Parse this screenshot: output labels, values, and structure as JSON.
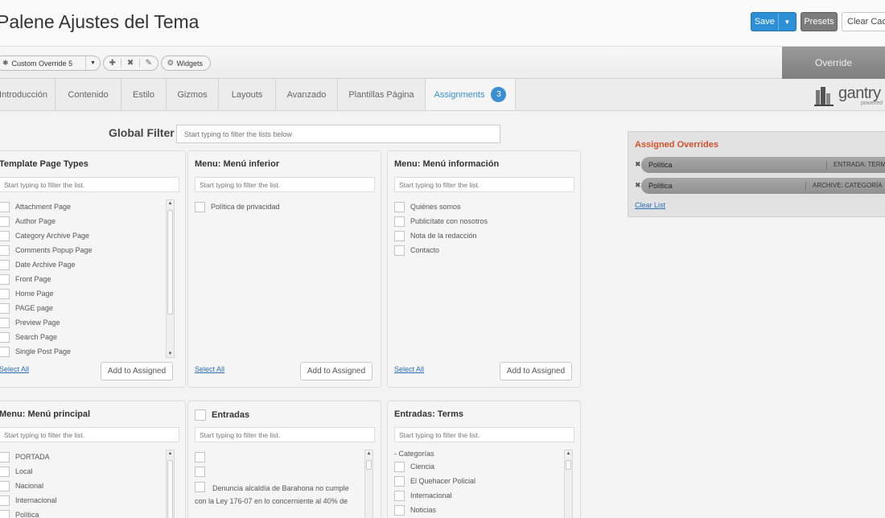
{
  "header": {
    "title": "Palene Ajustes del Tema",
    "save_label": "Save",
    "presets_label": "Presets",
    "clear_cache_label": "Clear Cache"
  },
  "toolbar": {
    "override_selector": "Custom Override 5",
    "widgets_label": "Widgets",
    "override_tag": "Override"
  },
  "tabs": [
    {
      "label": "Introducción"
    },
    {
      "label": "Contenido"
    },
    {
      "label": "Estilo"
    },
    {
      "label": "Gizmos"
    },
    {
      "label": "Layouts"
    },
    {
      "label": "Avanzado"
    },
    {
      "label": "Plantillas Página"
    },
    {
      "label": "Assignments",
      "badge": "3",
      "active": true
    }
  ],
  "logo": {
    "text": "gantry",
    "sub": "powered"
  },
  "global_filter": {
    "label": "Global Filter",
    "placeholder": "Start typing to filter the lists below"
  },
  "panels": {
    "template_page_types": {
      "title": "Template Page Types",
      "filter_placeholder": "Start typing to filter the list.",
      "items": [
        "Attachment Page",
        "Author Page",
        "Category Archive Page",
        "Comments Popup Page",
        "Date Archive Page",
        "Front Page",
        "Home Page",
        "PAGE page",
        "Preview Page",
        "Search Page",
        "Single Post Page"
      ],
      "select_all": "Select All",
      "add_label": "Add to Assigned"
    },
    "menu_inferior": {
      "title": "Menu: Menú inferior",
      "filter_placeholder": "Start typing to filter the list.",
      "items": [
        "Política de privacidad"
      ],
      "select_all": "Select All",
      "add_label": "Add to Assigned"
    },
    "menu_informacion": {
      "title": "Menu: Menú información",
      "filter_placeholder": "Start typing to filter the list.",
      "items": [
        "Quiénes somos",
        "Publicítate con nosotros",
        "Nota de la redacción",
        "Contacto"
      ],
      "select_all": "Select All",
      "add_label": "Add to Assigned"
    },
    "menu_principal": {
      "title": "Menu: Menú principal",
      "filter_placeholder": "Start typing to filter the list.",
      "items": [
        "PORTADA",
        "Local",
        "Nacional",
        "Internacional",
        "Política"
      ]
    },
    "entradas": {
      "title": "Entradas",
      "filter_placeholder": "Start typing to filter the list.",
      "items": [
        "",
        "",
        "Denuncia alcaldía de Barahona no cumple con la Ley 176-07 en lo concerniente al 40% de"
      ]
    },
    "entradas_terms": {
      "title": "Entradas: Terms",
      "filter_placeholder": "Start typing to filter the list.",
      "group_label": "- Categorías",
      "items": [
        "Ciencia",
        "El Quehacer Policial",
        "Internacional",
        "Noticias"
      ]
    }
  },
  "assigned_overrides": {
    "title": "Assigned Overrides",
    "rows": [
      {
        "name": "Política",
        "type": "ENTRADA: TERM"
      },
      {
        "name": "Política",
        "type": "ARCHIVE: CATEGORÍA"
      }
    ],
    "clear_label": "Clear List"
  }
}
